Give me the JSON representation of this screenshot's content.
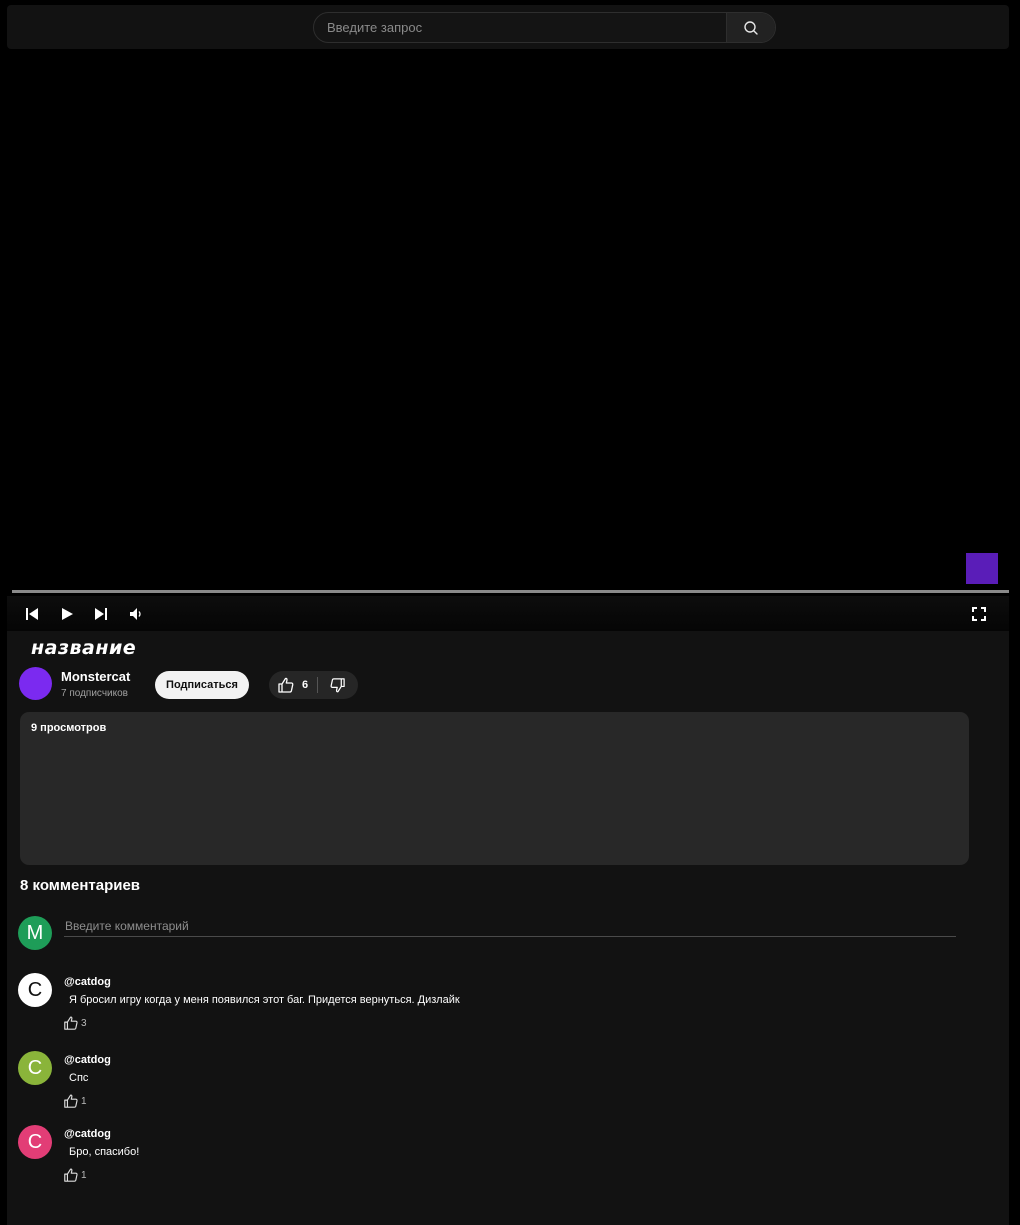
{
  "search": {
    "placeholder": "Введите запрос"
  },
  "video": {
    "title": "название",
    "accent_color": "#5a1db8"
  },
  "channel": {
    "name": "Monstercat",
    "subscribers": "7 подписчиков",
    "avatar_color": "#7b2af0"
  },
  "actions": {
    "subscribe_label": "Подписаться",
    "likes": "6"
  },
  "description": {
    "views": "9 просмотров"
  },
  "comments": {
    "heading": "8 комментариев",
    "input_placeholder": "Введите комментарий",
    "my_avatar_letter": "M",
    "items": [
      {
        "author": "@catdog",
        "text": "Я бросил игру когда у меня появился этот баг. Придется вернуться. Дизлайк",
        "likes": "3",
        "avatar_letter": "C",
        "avatar_color": "#ffffff"
      },
      {
        "author": "@catdog",
        "text": "Спс",
        "likes": "1",
        "avatar_letter": "C",
        "avatar_color": "#8ab43a"
      },
      {
        "author": "@catdog",
        "text": "Бро, спасибо!",
        "likes": "1",
        "avatar_letter": "C",
        "avatar_color": "#e23d76"
      }
    ]
  },
  "icons": {
    "search": "search-icon",
    "prev": "skip-previous-icon",
    "play": "play-icon",
    "next": "skip-next-icon",
    "volume": "volume-icon",
    "fullscreen": "fullscreen-icon",
    "like": "thumbs-up-icon",
    "dislike": "thumbs-down-icon"
  }
}
